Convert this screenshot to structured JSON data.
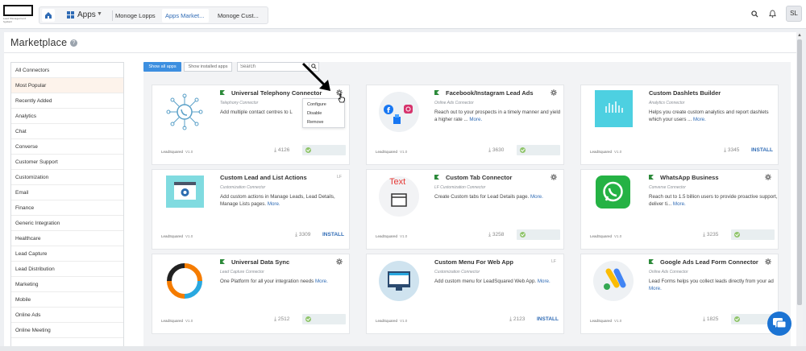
{
  "header": {
    "logo_sub": "Lead Management System",
    "apps_label": "Apps",
    "tabs": [
      "Monoge Lopps",
      "Apps Market...",
      "Monoge Cust..."
    ],
    "avatar": "SL"
  },
  "page": {
    "title": "Marketplace",
    "help": "?"
  },
  "sidebar": {
    "items": [
      "All Connectors",
      "Most Popular",
      "Recently Added",
      "Analytics",
      "Chat",
      "Converse",
      "Customer Support",
      "Customization",
      "Email",
      "Finance",
      "Generic Integration",
      "Healthcare",
      "Lead Capture",
      "Lead Distribution",
      "Marketing",
      "Mobile",
      "Online Ads",
      "Online Meeting"
    ],
    "selected": "Most Popular"
  },
  "filters": {
    "show_all": "Show all apps",
    "show_installed": "Show installed apps",
    "search_placeholder": "Search"
  },
  "cards": [
    {
      "title": "Universal Telephony Connector",
      "category": "Telephony Connector",
      "desc": "Add multiple contact centres to L",
      "more": "",
      "vendor": "LeadSquared",
      "version": "V1.0",
      "downloads": "4126",
      "status": "installed"
    },
    {
      "title": "Facebook/Instagram Lead Ads",
      "category": "Online Ads Connector",
      "desc": "Reach out to your prospects in a timely manner and yield a higher rate ... ",
      "more": "More.",
      "vendor": "LeadSquared",
      "version": "V1.0",
      "downloads": "3630",
      "status": "installed"
    },
    {
      "title": "Custom Dashlets Builder",
      "category": "Analytics Connector",
      "desc": "Helps you create custom analytics and report dashlets which your users ... ",
      "more": "More.",
      "vendor": "LeadSquared",
      "version": "V1.0",
      "downloads": "3345",
      "status": "install",
      "install_label": "INSTALL"
    },
    {
      "title": "Custom Lead and List Actions",
      "category": "Customization Connector",
      "desc": "Add custom actions in Manage Leads, Lead Details, Manage Lists pages. ",
      "more": "More.",
      "vendor": "LeadSquared",
      "version": "V1.0",
      "downloads": "3309",
      "status": "install",
      "install_label": "INSTALL",
      "lf": "LF"
    },
    {
      "title": "Custom Tab Connector",
      "category": "LF Customization Connector",
      "desc": "Create Custom tabs for Lead Details page. ",
      "more": "More.",
      "vendor": "LeadSquared",
      "version": "V1.0",
      "downloads": "3258",
      "status": "installed",
      "icon_text": "Text"
    },
    {
      "title": "WhatsApp Business",
      "category": "Converse Connector",
      "desc": "Reach out to 1.5 billion users to provide proactive support, deliver ti... ",
      "more": "More.",
      "vendor": "LeadSquared",
      "version": "V1.0",
      "downloads": "3235",
      "status": "installed"
    },
    {
      "title": "Universal Data Sync",
      "category": "Lead Capture Connector",
      "desc": "One Platform for all your integration needs ",
      "more": "More.",
      "vendor": "LeadSquared",
      "version": "V1.0",
      "downloads": "2512",
      "status": "installed"
    },
    {
      "title": "Custom Menu For Web App",
      "category": "Customization Connector",
      "desc": "Add custom menu for LeadSquared Web App. ",
      "more": "More.",
      "vendor": "LeadSquared",
      "version": "V1.0",
      "downloads": "2123",
      "status": "install",
      "install_label": "INSTALL",
      "lf": "LF"
    },
    {
      "title": "Google Ads Lead Form Connector",
      "category": "Online Ads Connector",
      "desc": "Lead Forms helps you collect leads directly from your ad ",
      "more": "More.",
      "vendor": "LeadSquared",
      "version": "V1.0",
      "downloads": "1825",
      "status": "installed"
    }
  ],
  "dropdown": {
    "items": [
      "Configure",
      "Disable",
      "Remove"
    ]
  },
  "colors": {
    "accent": "#3d8fe0",
    "link": "#2f6bb5",
    "installed_green": "#8fc46a",
    "selected_sidebar": "#fdf3eb"
  }
}
